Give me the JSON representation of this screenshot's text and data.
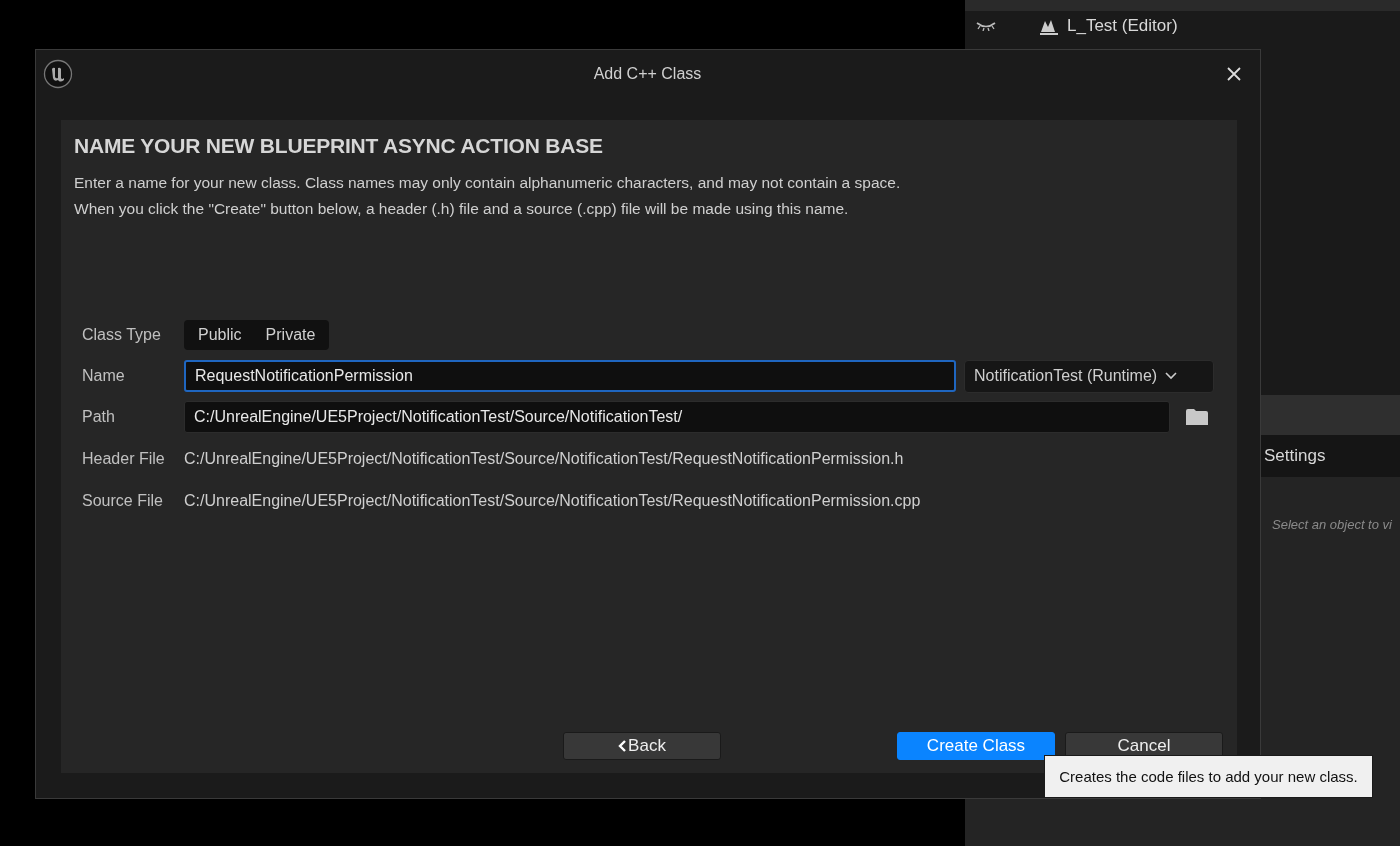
{
  "editor": {
    "outliner_row": {
      "label": "L_Test (Editor)"
    },
    "details": {
      "tab": "Settings",
      "hint": "Select an object to vi"
    }
  },
  "dialog": {
    "title": "Add C++ Class",
    "heading": "NAME YOUR NEW BLUEPRINT ASYNC ACTION BASE",
    "description": [
      "Enter a name for your new class. Class names may only contain alphanumeric characters, and may not contain a space.",
      "When you click the \"Create\" button below, a header (.h) file and a source (.cpp) file will be made using this name."
    ],
    "form": {
      "class_type": {
        "label": "Class Type",
        "options": [
          {
            "label": "Public"
          },
          {
            "label": "Private"
          }
        ]
      },
      "name": {
        "label": "Name",
        "value": "RequestNotificationPermission",
        "focused": true
      },
      "module": "NotificationTest (Runtime)",
      "path": {
        "label": "Path",
        "value": "C:/UnrealEngine/UE5Project/NotificationTest/Source/NotificationTest/"
      },
      "header_file": {
        "label": "Header File",
        "value": "C:/UnrealEngine/UE5Project/NotificationTest/Source/NotificationTest/RequestNotificationPermission.h"
      },
      "source_file": {
        "label": "Source File",
        "value": "C:/UnrealEngine/UE5Project/NotificationTest/Source/NotificationTest/RequestNotificationPermission.cpp"
      }
    },
    "buttons": [
      {
        "label": "Back",
        "kind": "back"
      },
      {
        "label": "Create Class",
        "kind": "primary"
      },
      {
        "label": "Cancel",
        "kind": "normal"
      }
    ]
  },
  "tooltip": "Creates the code files to add your new class."
}
